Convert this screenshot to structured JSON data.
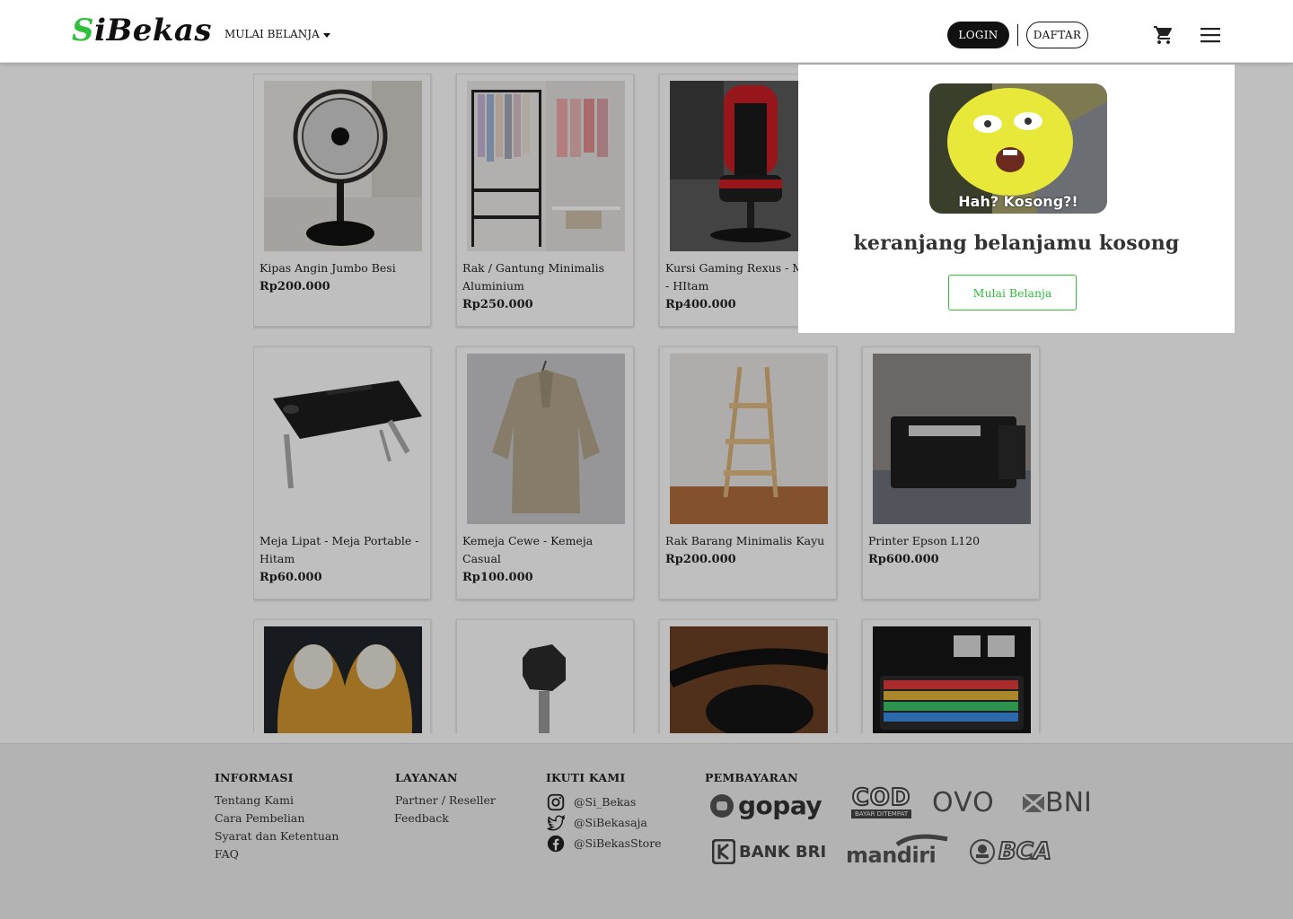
{
  "header": {
    "logo_first": "S",
    "logo_rest": "iBekas",
    "shop_menu": "MULAI BELANJA",
    "login": "LOGIN",
    "register": "DAFTAR"
  },
  "products": [
    {
      "name": "Kipas Angin Jumbo Besi",
      "price": "Rp200.000"
    },
    {
      "name": "Rak / Gantung Minimalis Aluminium",
      "price": "Rp250.000"
    },
    {
      "name": "Kursi Gaming Rexus - Merah - HItam",
      "price": "Rp400.000"
    },
    {
      "name": "",
      "price": ""
    },
    {
      "name": "Meja Lipat - Meja Portable - Hitam",
      "price": "Rp60.000"
    },
    {
      "name": "Kemeja Cewe - Kemeja Casual",
      "price": "Rp100.000"
    },
    {
      "name": "Rak Barang Minimalis Kayu",
      "price": "Rp200.000"
    },
    {
      "name": "Printer Epson L120",
      "price": "Rp600.000"
    },
    {
      "name": "",
      "price": ""
    },
    {
      "name": "",
      "price": ""
    },
    {
      "name": "",
      "price": ""
    },
    {
      "name": "",
      "price": ""
    }
  ],
  "cart_popup": {
    "meme_caption": "Hah? Kosong?!",
    "empty_message": "keranjang belanjamu kosong",
    "start_button": "Mulai Belanja"
  },
  "footer": {
    "info": {
      "heading": "INFORMASI",
      "links": [
        "Tentang Kami",
        "Cara Pembelian",
        "Syarat dan Ketentuan",
        "FAQ"
      ]
    },
    "services": {
      "heading": "LAYANAN",
      "links": [
        "Partner / Reseller",
        "Feedback"
      ]
    },
    "follow": {
      "heading": "IKUTI KAMI",
      "instagram": "@Si_Bekas",
      "twitter": "@SiBekasaja",
      "facebook": "@SiBekasStore"
    },
    "payment": {
      "heading": "PEMBAYARAN",
      "methods": [
        "gopay",
        "COD",
        "BAYAR DITEMPAT",
        "OVO",
        "BNI",
        "BANK BRI",
        "mandiri",
        "BCA"
      ]
    }
  },
  "colors": {
    "accent_green": "#2fbf3a",
    "dark": "#111111",
    "overlay": "rgba(0,0,0,0.25)"
  }
}
